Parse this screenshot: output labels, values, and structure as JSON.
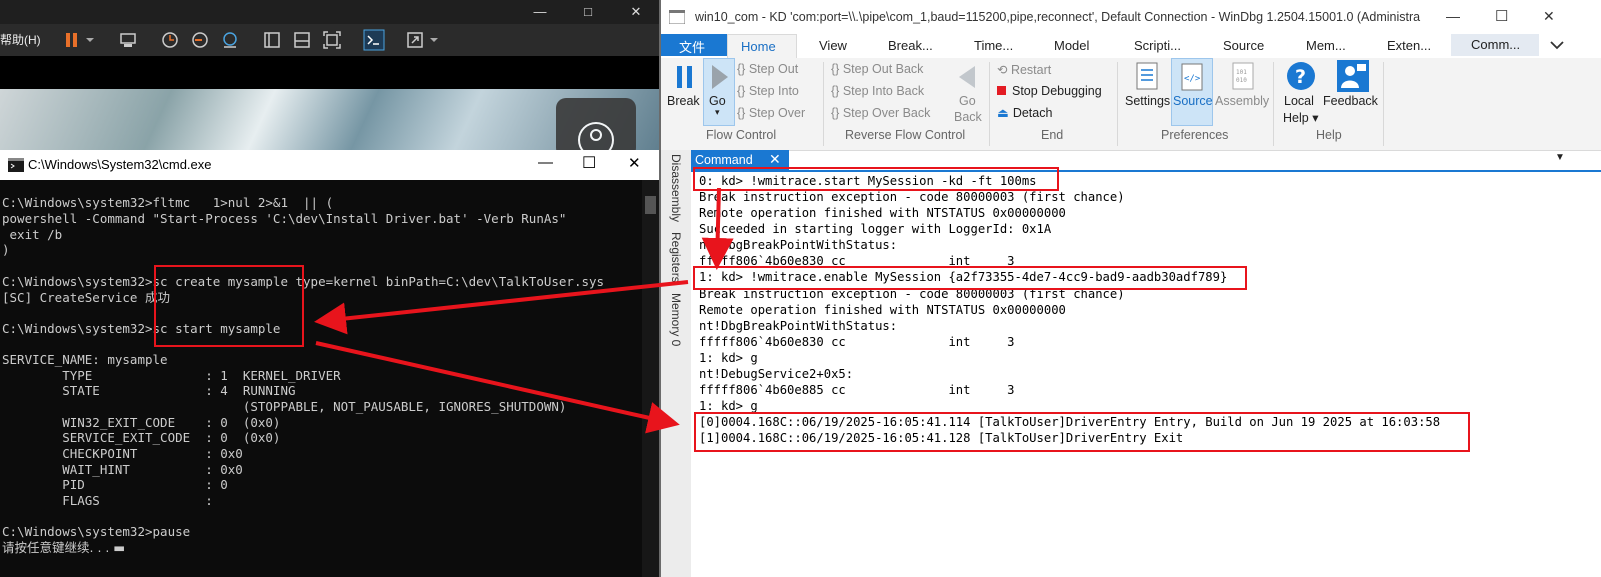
{
  "vm": {
    "titlebar": {
      "minimize": "—",
      "maximize": "□",
      "close": "✕"
    },
    "menu_help": "帮助(H)",
    "toolbar_icons": [
      "pause-icon",
      "dropdown-icon",
      "send-keys-icon",
      "snapshot-icon",
      "revert-icon",
      "manage-snapshot-icon",
      "view-single-icon",
      "view-split-icon",
      "fullscreen-icon",
      "console-icon",
      "stretch-icon",
      "dropdown-icon"
    ]
  },
  "cmd": {
    "title": "C:\\Windows\\System32\\cmd.exe",
    "controls": {
      "minimize": "—",
      "maximize": "☐",
      "close": "✕"
    },
    "lines": [
      "C:\\Windows\\system32>fltmc   1>nul 2>&1  || (",
      "powershell -Command \"Start-Process 'C:\\dev\\Install Driver.bat' -Verb RunAs\"",
      " exit /b",
      ")",
      "",
      "C:\\Windows\\system32>sc create mysample type=kernel binPath=C:\\dev\\TalkToUser.sys",
      "[SC] CreateService 成功",
      "",
      "C:\\Windows\\system32>sc start mysample",
      "",
      "SERVICE_NAME: mysample",
      "        TYPE               : 1  KERNEL_DRIVER",
      "        STATE              : 4  RUNNING",
      "                                (STOPPABLE, NOT_PAUSABLE, IGNORES_SHUTDOWN)",
      "        WIN32_EXIT_CODE    : 0  (0x0)",
      "        SERVICE_EXIT_CODE  : 0  (0x0)",
      "        CHECKPOINT         : 0x0",
      "        WAIT_HINT          : 0x0",
      "        PID                : 0",
      "        FLAGS              :",
      "",
      "C:\\Windows\\system32>pause",
      "请按任意键继续. . . ▬"
    ]
  },
  "windbg": {
    "title": "win10_com - KD 'com:port=\\\\.\\pipe\\com_1,baud=115200,pipe,reconnect', Default Connection  - WinDbg 1.2504.15001.0 (Administra",
    "controls": {
      "minimize": "—",
      "maximize": "☐",
      "close": "✕"
    },
    "ribbon_tabs": [
      "文件",
      "Home",
      "View",
      "Break...",
      "Time...",
      "Model",
      "Scripti...",
      "Source",
      "Mem...",
      "Exten...",
      "Comm..."
    ],
    "ribbon": {
      "break": "Break",
      "go": "Go",
      "step_out": "Step Out",
      "step_into": "Step Into",
      "step_over": "Step Over",
      "step_out_back": "Step Out Back",
      "step_into_back": "Step Into Back",
      "step_over_back": "Step Over Back",
      "go_back_1": "Go",
      "go_back_2": "Back",
      "restart": "Restart",
      "stop_debugging": "Stop Debugging",
      "detach": "Detach",
      "settings": "Settings",
      "source": "Source",
      "assembly": "Assembly",
      "local_help_1": "Local",
      "local_help_2": "Help",
      "feedback": "Feedback",
      "groups": [
        "Flow Control",
        "Reverse Flow Control",
        "End",
        "Preferences",
        "Help"
      ]
    },
    "dock_tabs": [
      "Disassembly",
      "Registers",
      "Memory 0"
    ],
    "command_tab": "Command",
    "output": [
      "0: kd> !wmitrace.start MySession -kd -ft 100ms",
      "Break instruction exception - code 80000003 (first chance)",
      "Remote operation finished with NTSTATUS 0x00000000",
      "Succeeded in starting logger with LoggerId: 0x1A",
      "nt!DbgBreakPointWithStatus:",
      "fffff806`4b60e830 cc              int     3",
      "1: kd> !wmitrace.enable MySession {a2f73355-4de7-4cc9-bad9-aadb30adf789}",
      "Break instruction exception - code 80000003 (first chance)",
      "Remote operation finished with NTSTATUS 0x00000000",
      "nt!DbgBreakPointWithStatus:",
      "fffff806`4b60e830 cc              int     3",
      "1: kd> g",
      "nt!DebugService2+0x5:",
      "fffff806`4b60e885 cc              int     3",
      "1: kd> g",
      "[0]0004.168C::06/19/2025-16:05:41.114 [TalkToUser]DriverEntry Entry, Build on Jun 19 2025 at 16:03:58",
      "[1]0004.168C::06/19/2025-16:05:41.128 [TalkToUser]DriverEntry Exit"
    ]
  },
  "colors": {
    "highlight": "#e8141c",
    "accent": "#1a78d2"
  }
}
